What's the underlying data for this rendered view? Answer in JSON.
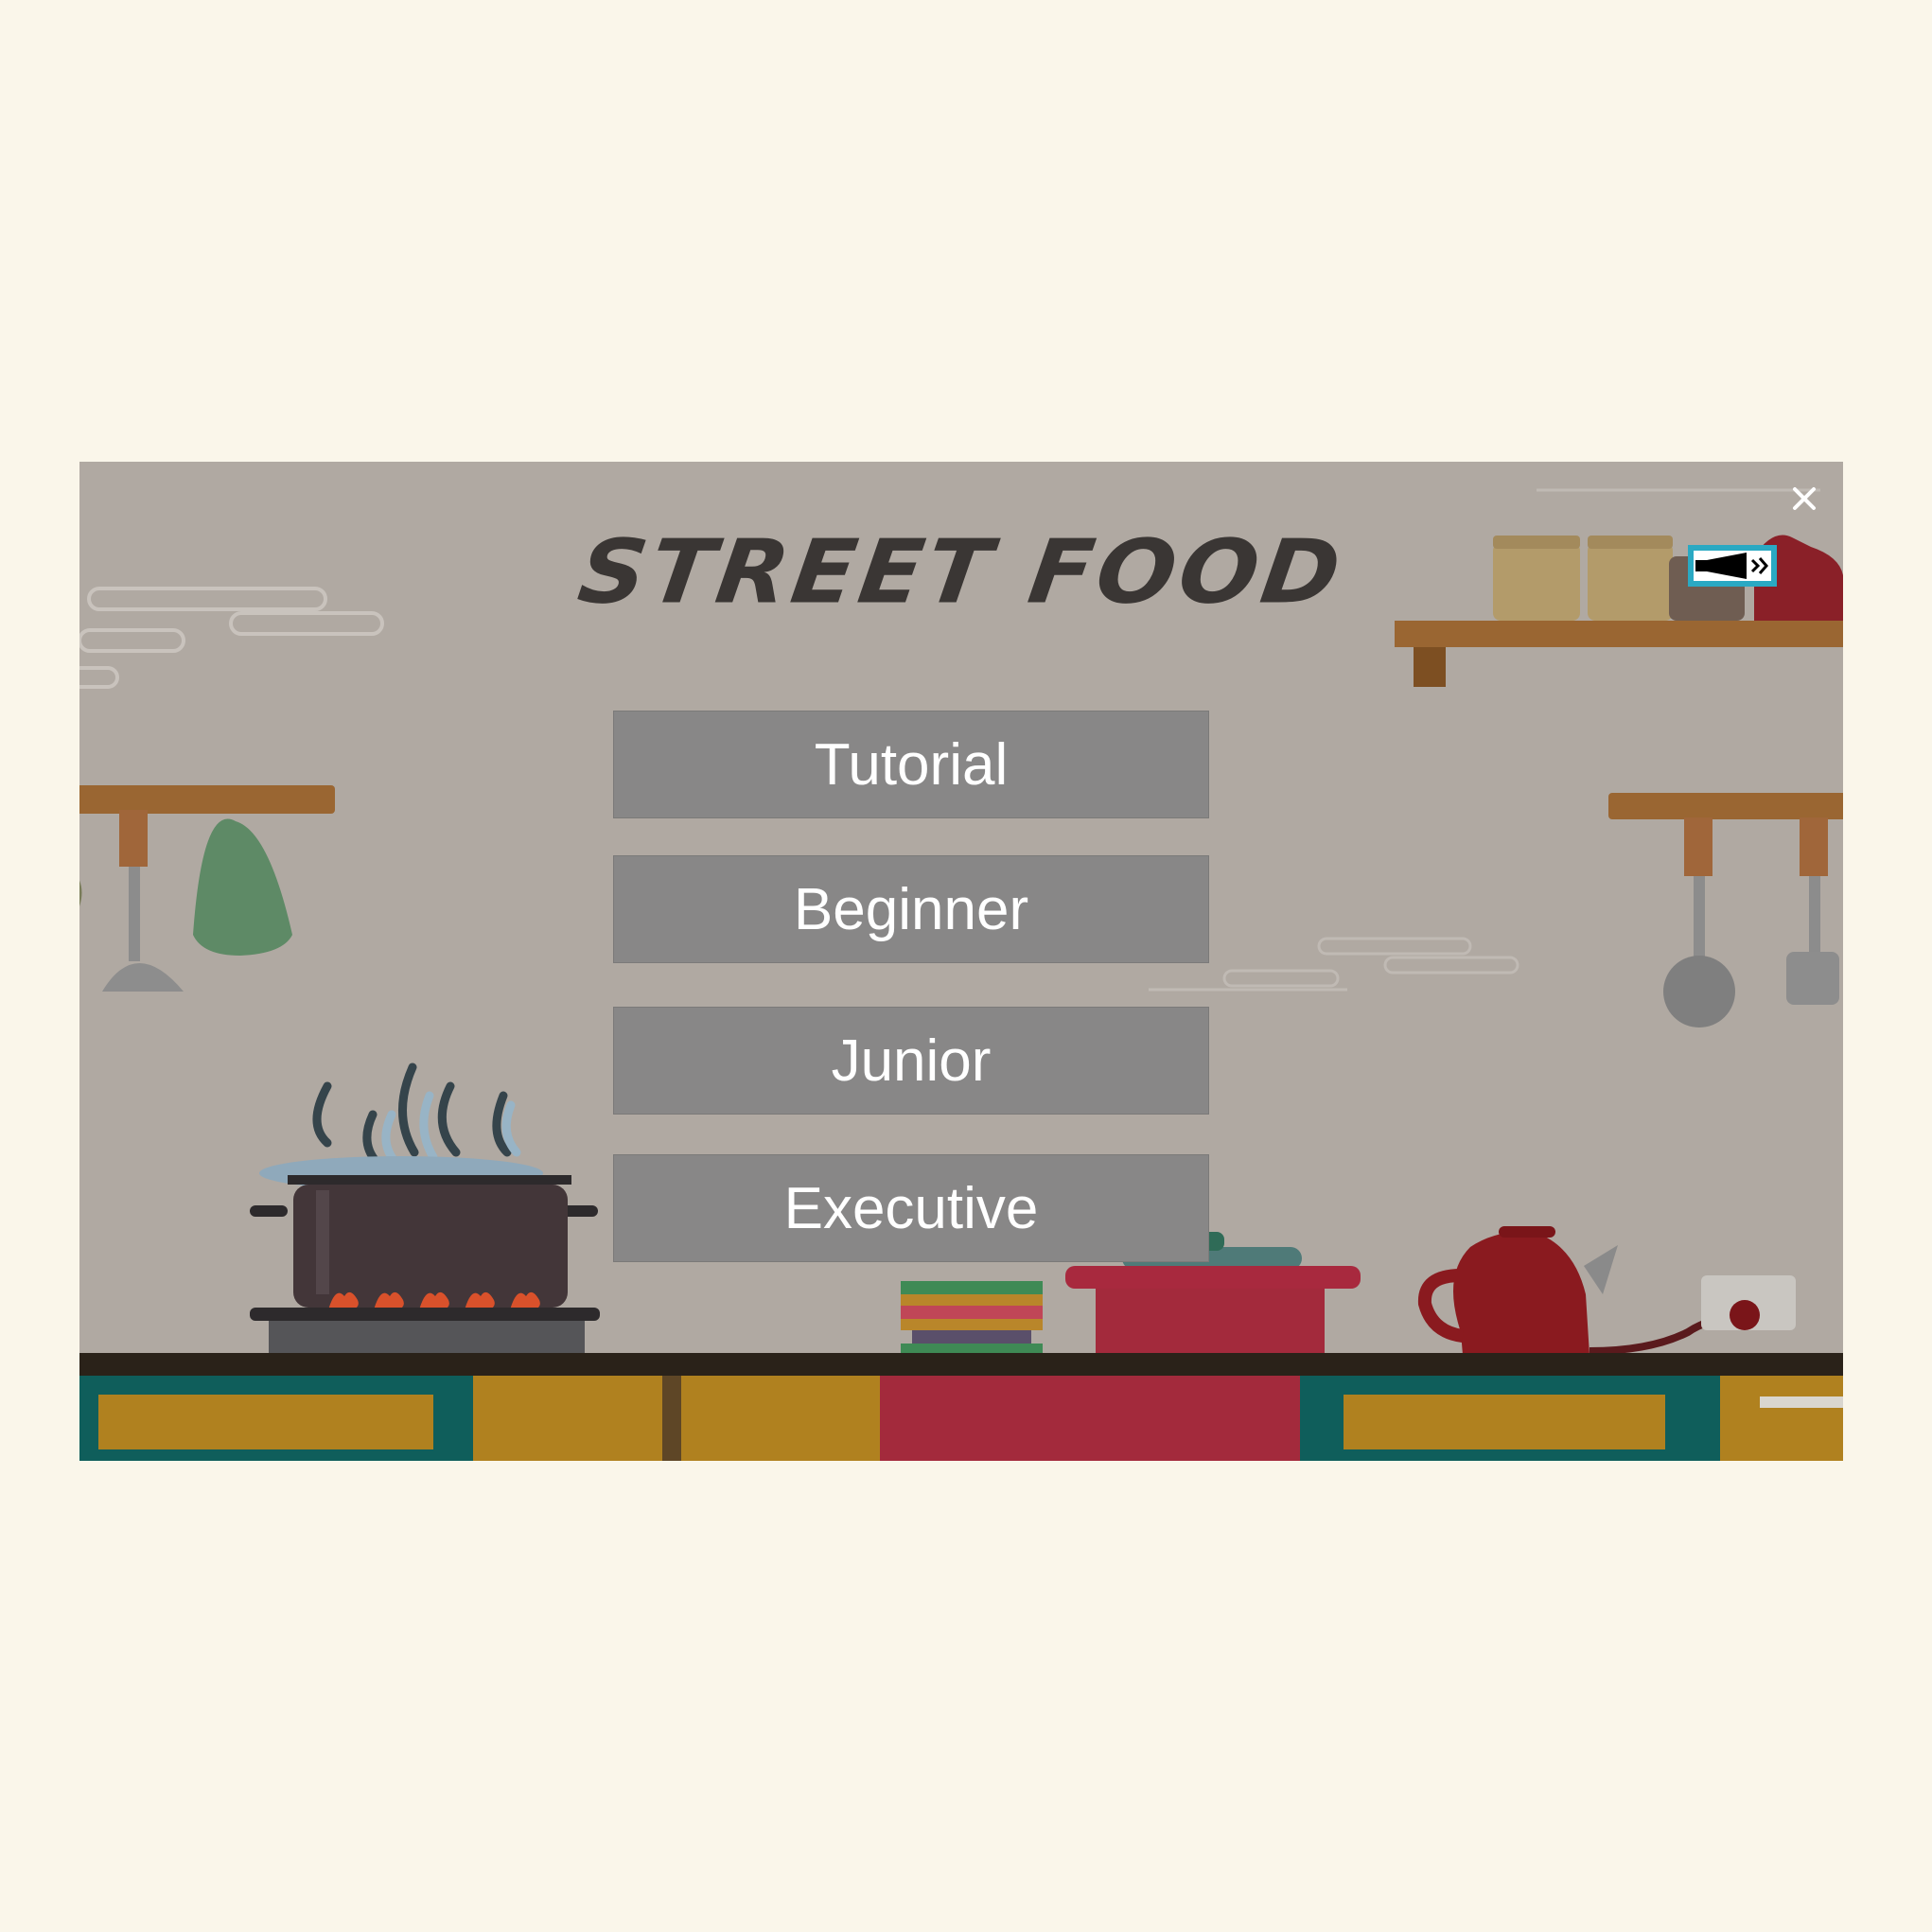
{
  "game": {
    "title": "STREET FOOD",
    "close_icon": "close-icon",
    "sound_icon": "sound-icon"
  },
  "menu": {
    "items": [
      {
        "label": "Tutorial"
      },
      {
        "label": "Beginner"
      },
      {
        "label": "Junior"
      },
      {
        "label": "Executive"
      }
    ]
  },
  "colors": {
    "page_background": "#faf6ea",
    "game_background": "#b0a9a2",
    "button_fill": "#888787",
    "button_text": "#ffffff",
    "title_text": "#3a3634",
    "sound_button_frame": "#2aa9c3"
  }
}
